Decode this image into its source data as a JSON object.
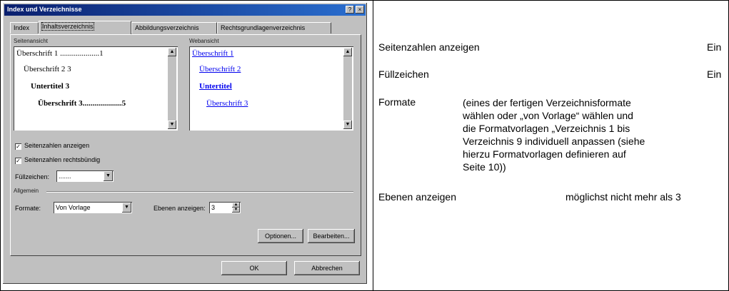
{
  "dialog": {
    "title": "Index und Verzeichnisse",
    "tabs": [
      "Index",
      "Inhaltsverzeichnis",
      "Abbildungsverzeichnis",
      "Rechtsgrundlagenverzeichnis"
    ],
    "print_preview_label": "Seitenansicht",
    "web_preview_label": "Webansicht",
    "print_preview_lines": [
      {
        "text": "Überschrift 1",
        "dots": "....................",
        "page": "1"
      },
      {
        "text": "Überschrift 2",
        "dots": "",
        "page": "3"
      },
      {
        "text": "Untertitel",
        "dots": "",
        "page": "3"
      },
      {
        "text": "Überschrift 3",
        "dots": "....................",
        "page": "5"
      }
    ],
    "web_preview_lines": [
      "Überschrift 1",
      "Überschrift 2",
      "Untertitel",
      "Überschrift 3"
    ],
    "show_page_numbers_label": "Seitenzahlen anzeigen",
    "align_right_label": "Seitenzahlen rechtsbündig",
    "fill_char_label": "Füllzeichen:",
    "fill_char_value": ".......",
    "general_label": "Allgemein",
    "formats_label": "Formate:",
    "formats_value": "Von Vorlage",
    "levels_label": "Ebenen anzeigen:",
    "levels_value": "3",
    "options_button": "Optionen...",
    "edit_button": "Bearbeiten...",
    "ok_button": "OK",
    "cancel_button": "Abbrechen"
  },
  "settings": {
    "page_numbers": {
      "label": "Seitenzahlen anzeigen",
      "value": "Ein"
    },
    "fill_chars": {
      "label": "Füllzeichen",
      "value": "Ein"
    },
    "formats": {
      "label": "Formate",
      "lines": [
        "(eines der fertigen Verzeichnisformate",
        "wählen oder „von Vorlage“ wählen und",
        "die Formatvorlagen „Verzeichnis 1 bis",
        "Verzeichnis 9 individuell anpassen (siehe",
        "hierzu Formatvorlagen definieren auf",
        "Seite 10))"
      ]
    },
    "levels": {
      "label": "Ebenen anzeigen",
      "value": "möglichst nicht mehr als 3"
    }
  }
}
